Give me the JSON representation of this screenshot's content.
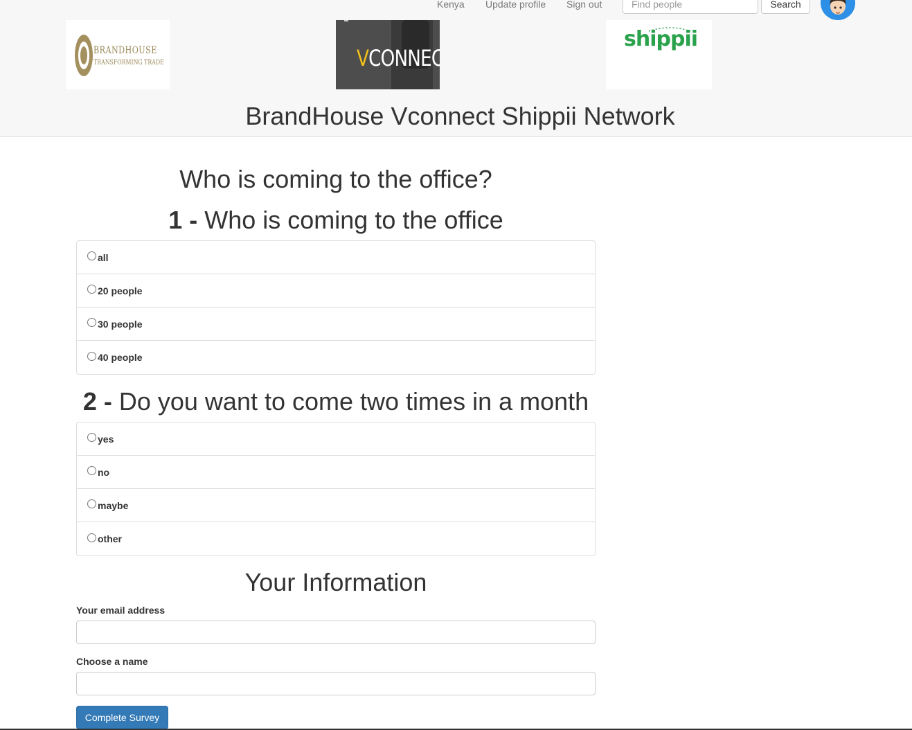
{
  "nav": {
    "country": "Kenya",
    "update_profile": "Update profile",
    "sign_out": "Sign out",
    "find_placeholder": "Find people",
    "search_label": "Search"
  },
  "logos": {
    "brandhouse_name": "BRANDHOUSE",
    "brandhouse_tagline": "TRANSFORMING TRADE",
    "vconnect_v": "V",
    "vconnect_rest": "CONNECT",
    "shippii": "shippii"
  },
  "site_title": "BrandHouse Vconnect Shippii Network",
  "survey": {
    "title": "Who is coming to the office?",
    "questions": [
      {
        "number": "1",
        "separator": " - ",
        "text": "Who is coming to the office",
        "options": [
          "all",
          "20 people",
          "30 people",
          "40 people"
        ]
      },
      {
        "number": "2",
        "separator": " - ",
        "text": "Do you want to come two times in a month",
        "options": [
          "yes",
          "no",
          "maybe",
          "other"
        ]
      }
    ]
  },
  "info": {
    "title": "Your Information",
    "email_label": "Your email address",
    "email_value": "",
    "name_label": "Choose a name",
    "name_value": "",
    "submit_label": "Complete Survey"
  },
  "colors": {
    "header_bg": "#f7f7f7",
    "primary_button": "#337ab7",
    "avatar_bg": "#2e8fe6",
    "shippii_green": "#2aa24c"
  }
}
